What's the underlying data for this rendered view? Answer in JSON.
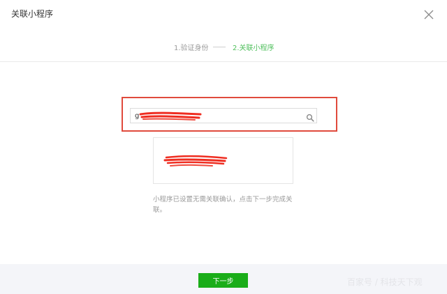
{
  "dialog": {
    "title": "关联小程序"
  },
  "steps": [
    {
      "label": "1.验证身份",
      "state": "done"
    },
    {
      "label": "2.关联小程序",
      "state": "active"
    }
  ],
  "search": {
    "value": "g"
  },
  "notice": "小程序已设置无需关联确认，点击下一步完成关联。",
  "footer": {
    "next_label": "下一步"
  },
  "watermark": "百家号 / 科技天下观",
  "colors": {
    "accent_green": "#1aad19",
    "step_active": "#4ebf5b",
    "highlight_red": "#e04a3c"
  }
}
